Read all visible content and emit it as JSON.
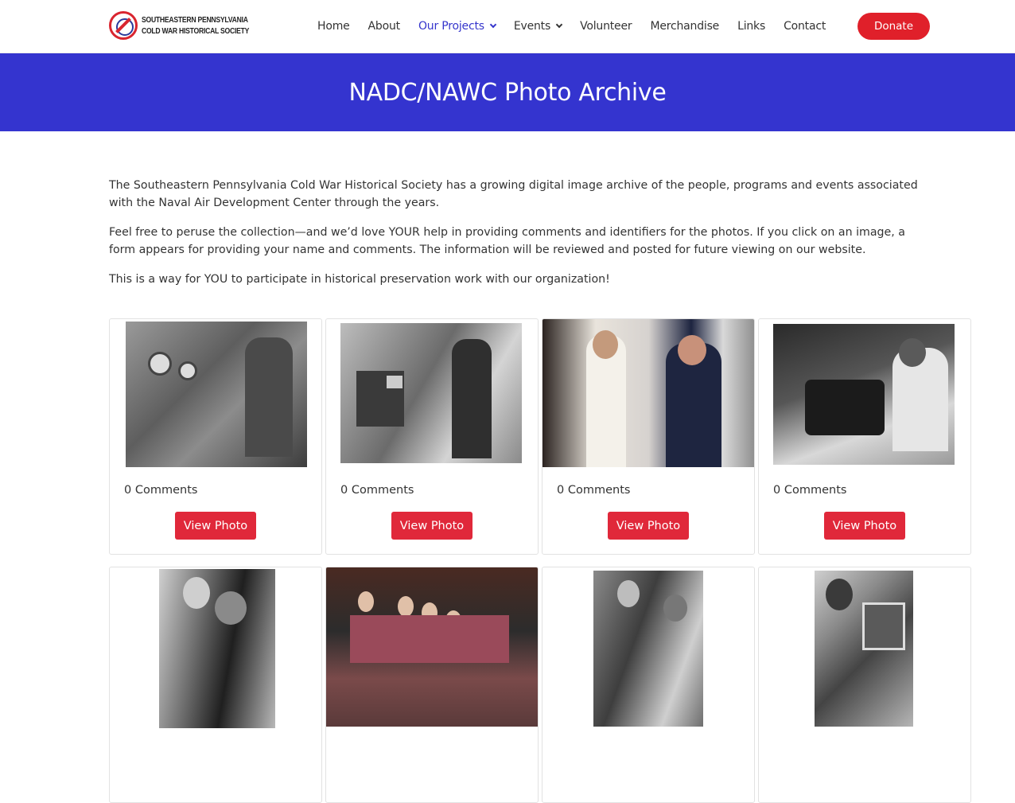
{
  "header": {
    "logo_line1": "SOUTHEASTERN PENNSYLVANIA",
    "logo_line2": "COLD WAR HISTORICAL SOCIETY",
    "nav": [
      {
        "label": "Home"
      },
      {
        "label": "About"
      },
      {
        "label": "Our Projects",
        "dropdown": true,
        "active": true
      },
      {
        "label": "Events",
        "dropdown": true
      },
      {
        "label": "Volunteer"
      },
      {
        "label": "Merchandise"
      },
      {
        "label": "Links"
      },
      {
        "label": "Contact"
      }
    ],
    "donate_label": "Donate"
  },
  "banner": {
    "title": "NADC/NAWC Photo Archive",
    "color": "#3434cf"
  },
  "intro": {
    "p1": "The Southeastern Pennsylvania Cold War Historical Society has a growing digital image archive of the people, programs and events associated with the Naval Air Development Center through the years.",
    "p2": "Feel free to peruse the collection—and we’d love YOUR help in providing comments and identifiers for the photos. If you click on an image, a form appears for providing your name and comments. The information will be reviewed and posted for future viewing on our website.",
    "p3": "This is a way for YOU to participate in historical preservation work with our organization!"
  },
  "gallery": {
    "cards": [
      {
        "comments": "0 Comments",
        "button": "View Photo"
      },
      {
        "comments": "0 Comments",
        "button": "View Photo"
      },
      {
        "comments": "0 Comments",
        "button": "View Photo"
      },
      {
        "comments": "0 Comments",
        "button": "View Photo"
      },
      {
        "comments": "",
        "button": ""
      },
      {
        "comments": "",
        "button": ""
      },
      {
        "comments": "",
        "button": ""
      },
      {
        "comments": "",
        "button": ""
      }
    ]
  },
  "colors": {
    "accent": "#3434cf",
    "donate": "#e0202a",
    "view_button": "#e0283a"
  }
}
